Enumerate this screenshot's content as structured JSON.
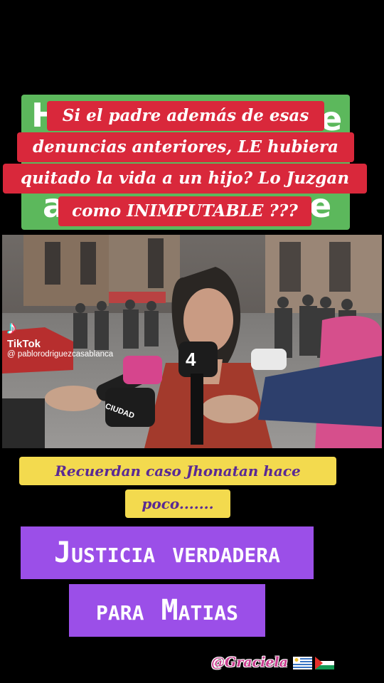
{
  "top_caption": {
    "lines": [
      "Si el padre además de esas",
      "denuncias anteriores, LE hubiera",
      "quitado la vida a un hijo?  Lo Juzgan",
      "como   INIMPUTABLE ???"
    ],
    "bg_color": "#d9283b",
    "behind_letters": [
      "H",
      "e",
      "a",
      "e"
    ],
    "behind_color": "#5cb85c"
  },
  "video": {
    "tiktok_label": "TikTok",
    "tiktok_user": "@ pablorodriguezcasablanca",
    "mic_labels": [
      "4",
      "CIUDAD"
    ]
  },
  "middle_caption": {
    "lines": [
      "Recuerdan caso Jhonatan hace",
      "poco......."
    ],
    "bg_color": "#f3da4e",
    "text_color": "#5a2a94"
  },
  "bottom_caption": {
    "lines": [
      "Justicia verdadera",
      "para Matias"
    ],
    "bg_color": "#9b4fe8"
  },
  "signature": {
    "text": "@Graciela",
    "flags": [
      "uruguay-flag-icon",
      "palestine-flag-icon"
    ]
  }
}
